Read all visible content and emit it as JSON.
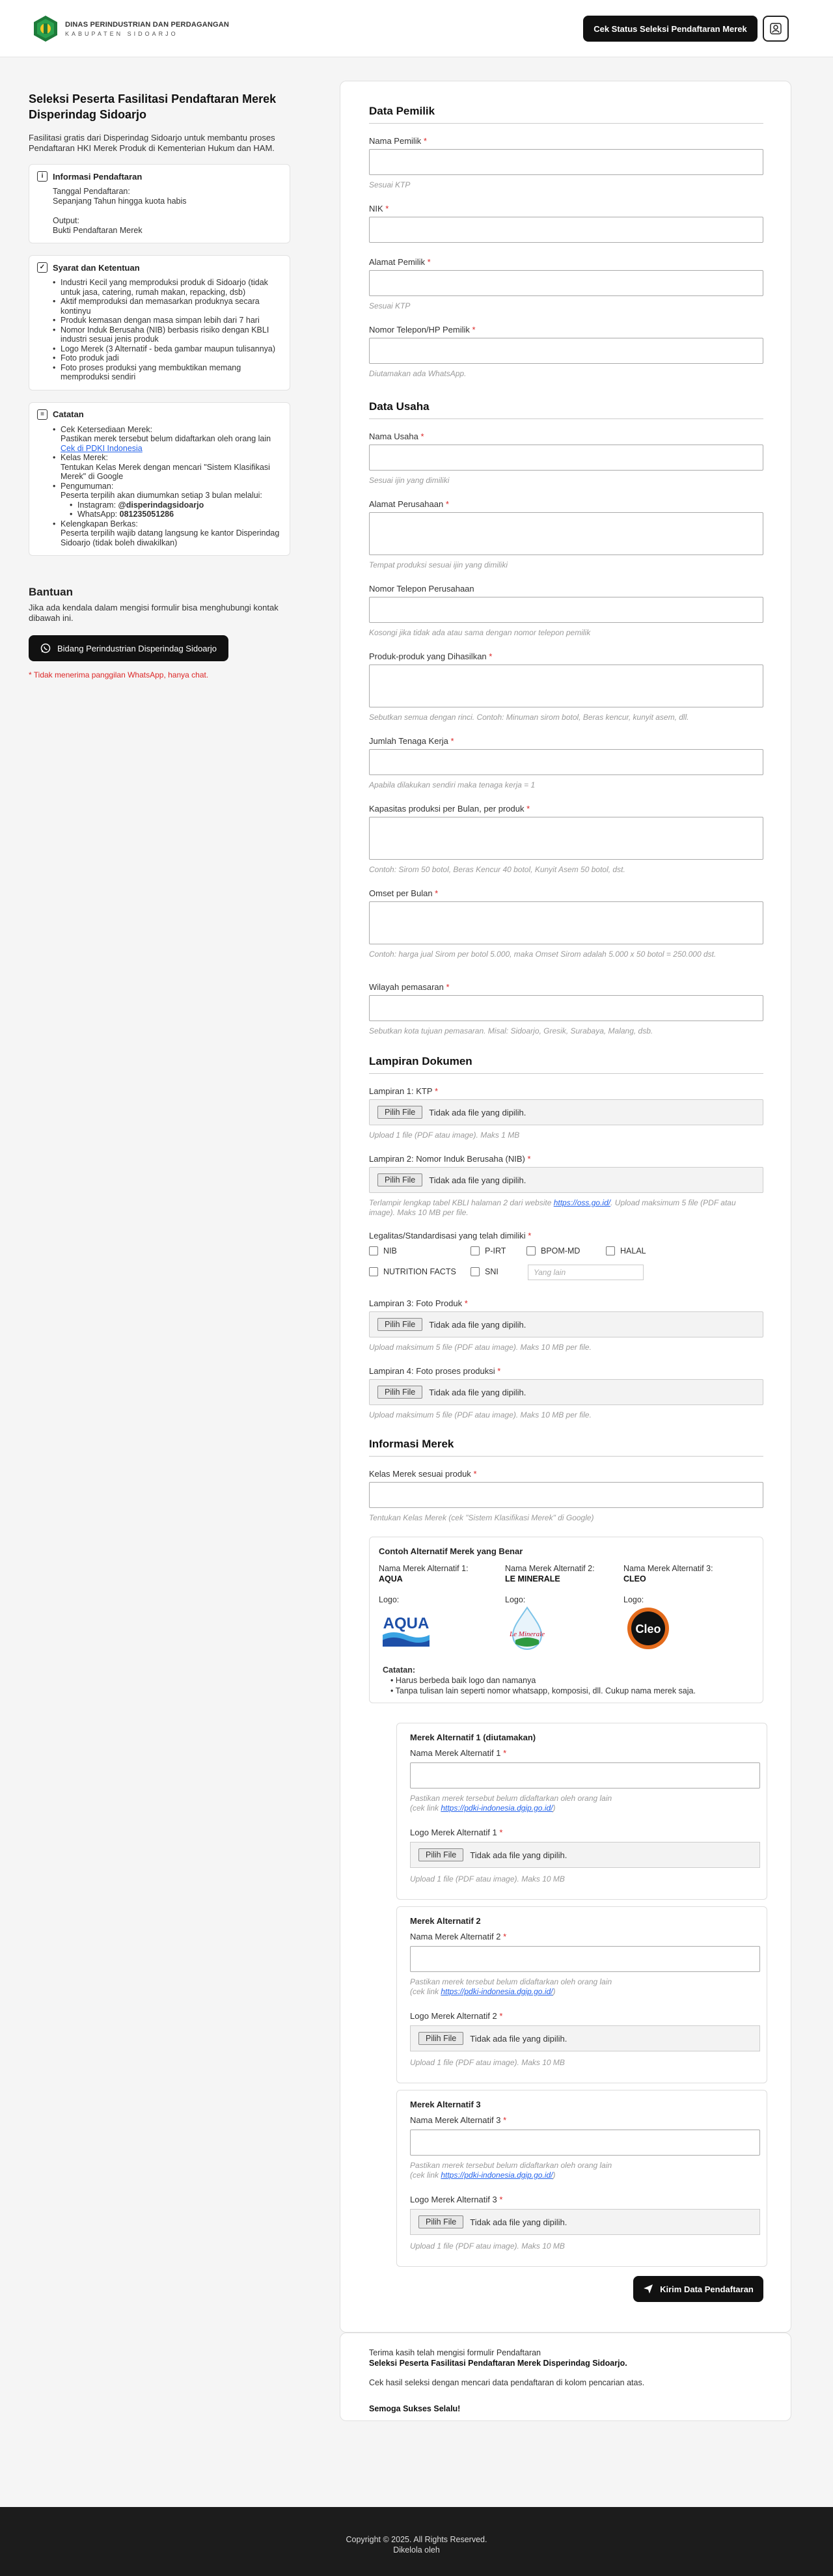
{
  "header": {
    "logo_line1": "DINAS PERINDUSTRIAN DAN PERDAGANGAN",
    "logo_line2": "KABUPATEN SIDOARJO",
    "cek_status": "Cek Status Seleksi Pendaftaran Merek"
  },
  "left": {
    "title": "Seleksi Peserta Fasilitasi Pendaftaran Merek Disperindag Sidoarjo",
    "intro": "Fasilitasi gratis dari Disperindag Sidoarjo untuk membantu proses Pendaftaran HKI Merek Produk di Kementerian Hukum dan HAM.",
    "info": {
      "title": "Informasi Pendaftaran",
      "tanggal_label": "Tanggal Pendaftaran:",
      "tanggal_value": "Sepanjang Tahun hingga kuota habis",
      "output_label": "Output:",
      "output_value": "Bukti Pendaftaran Merek"
    },
    "syarat": {
      "title": "Syarat dan Ketentuan",
      "items": [
        "Industri Kecil yang memproduksi produk di Sidoarjo (tidak untuk jasa, catering, rumah makan, repacking, dsb)",
        "Aktif memproduksi dan memasarkan produknya secara kontinyu",
        "Produk kemasan dengan masa simpan lebih dari 7 hari",
        "Nomor Induk Berusaha (NIB) berbasis risiko dengan KBLI industri sesuai jenis produk",
        "Logo Merek (3 Alternatif - beda gambar maupun tulisannya)",
        "Foto produk jadi",
        "Foto proses produksi yang membuktikan memang memproduksi sendiri"
      ]
    },
    "catatan": {
      "title": "Catatan",
      "i1_title": "Cek Ketersediaan Merek:",
      "i1_text": "Pastikan merek tersebut belum didaftarkan oleh orang lain",
      "i1_link": "Cek di PDKI Indonesia",
      "i2_title": "Kelas Merek:",
      "i2_text": "Tentukan Kelas Merek dengan mencari \"Sistem Klasifikasi Merek\" di Google",
      "i3_title": "Pengumuman:",
      "i3_text": "Peserta terpilih akan diumumkan setiap 3 bulan melalui:",
      "instagram_label": "Instagram:",
      "instagram_value": "@disperindagsidoarjo",
      "whatsapp_label": "WhatsApp:",
      "whatsapp_value": "081235051286",
      "i4_title": "Kelengkapan Berkas:",
      "i4_text": "Peserta terpilih wajib datang langsung ke kantor Disperindag Sidoarjo (tidak boleh diwakilkan)"
    },
    "bantuan": {
      "title": "Bantuan",
      "text": "Jika ada kendala dalam mengisi formulir bisa menghubungi kontak dibawah ini.",
      "wa_button": "Bidang Perindustrian Disperindag Sidoarjo",
      "wa_note": "* Tidak menerima panggilan WhatsApp, hanya chat."
    }
  },
  "form": {
    "pemilik_title": "Data Pemilik",
    "nama_pemilik": "Nama Pemilik",
    "nama_pemilik_hint": "Sesuai KTP",
    "nik": "NIK",
    "alamat_pemilik": "Alamat Pemilik",
    "alamat_pemilik_hint": "Sesuai KTP",
    "telp_pemilik": "Nomor Telepon/HP Pemilik",
    "telp_pemilik_hint": "Diutamakan ada WhatsApp.",
    "usaha_title": "Data Usaha",
    "nama_usaha": "Nama Usaha",
    "nama_usaha_hint": "Sesuai ijin yang dimiliki",
    "alamat_perusahaan": "Alamat Perusahaan",
    "alamat_perusahaan_hint": "Tempat produksi sesuai ijin yang dimiliki",
    "telp_perusahaan": "Nomor Telepon Perusahaan",
    "telp_perusahaan_hint": "Kosongi jika tidak ada atau sama dengan nomor telepon pemilik",
    "produk": "Produk-produk yang Dihasilkan",
    "produk_hint": "Sebutkan semua dengan rinci. Contoh: Minuman sirom botol, Beras kencur, kunyit asem, dll.",
    "tenaga": "Jumlah Tenaga Kerja",
    "tenaga_hint": "Apabila dilakukan sendiri maka tenaga kerja = 1",
    "kapasitas": "Kapasitas produksi per Bulan, per produk",
    "kapasitas_hint": "Contoh: Sirom 50 botol, Beras Kencur 40 botol, Kunyit Asem 50 botol, dst.",
    "omset": "Omset per Bulan",
    "omset_hint": "Contoh: harga jual Sirom per botol 5.000, maka Omset Sirom adalah 5.000 x 50 botol = 250.000 dst.",
    "wilayah": "Wilayah pemasaran",
    "wilayah_hint": "Sebutkan kota tujuan pemasaran. Misal: Sidoarjo, Gresik, Surabaya, Malang, dsb.",
    "lampiran_title": "Lampiran Dokumen",
    "lamp1": "Lampiran 1: KTP",
    "lamp1_hint": "Upload 1 file (PDF atau image). Maks 1 MB",
    "lamp2": "Lampiran 2: Nomor Induk Berusaha (NIB)",
    "lamp2_hint_a": "Terlampir lengkap tabel KBLI halaman 2 dari website ",
    "lamp2_link": "https://oss.go.id/",
    "lamp2_hint_b": ". Upload maksimum 5 file (PDF atau image). Maks 10 MB per file.",
    "legalitas": "Legalitas/Standardisasi yang telah dimiliki",
    "legal_options": [
      "NIB",
      "P-IRT",
      "BPOM-MD",
      "HALAL",
      "NUTRITION FACTS",
      "SNI"
    ],
    "yang_lain": "Yang lain",
    "lamp3": "Lampiran 3: Foto Produk",
    "lamp3_hint": "Upload maksimum 5 file (PDF atau image). Maks 10 MB per file.",
    "lamp4": "Lampiran 4: Foto proses produksi",
    "lamp4_hint": "Upload maksimum 5 file (PDF atau image). Maks 10 MB per file.",
    "file_button": "Pilih File",
    "file_empty": "Tidak ada file yang dipilih.",
    "merek_title": "Informasi Merek",
    "kelas": "Kelas Merek sesuai produk",
    "kelas_hint": "Tentukan Kelas Merek (cek \"Sistem Klasifikasi Merek\" di Google)",
    "contoh_title": "Contoh Alternatif Merek yang Benar",
    "contoh": [
      {
        "label": "Nama Merek Alternatif 1:",
        "value": "AQUA",
        "logo_label": "Logo:",
        "logo_text": "AQUA"
      },
      {
        "label": "Nama Merek Alternatif 2:",
        "value": "LE MINERALE",
        "logo_label": "Logo:",
        "logo_text": "Le Minerale"
      },
      {
        "label": "Nama Merek Alternatif 3:",
        "value": "CLEO",
        "logo_label": "Logo:",
        "logo_text": "Cleo"
      }
    ],
    "contoh_catatan": "Catatan:",
    "contoh_notes": [
      "Harus berbeda baik logo dan namanya",
      "Tanpa tulisan lain seperti nomor whatsapp, komposisi, dll. Cukup nama merek saja."
    ],
    "alt": [
      {
        "title": "Merek Alternatif 1 (diutamakan)",
        "nama": "Nama Merek Alternatif 1",
        "logo": "Logo Merek Alternatif 1"
      },
      {
        "title": "Merek Alternatif 2",
        "nama": "Nama Merek Alternatif 2",
        "logo": "Logo Merek Alternatif 2"
      },
      {
        "title": "Merek Alternatif 3",
        "nama": "Nama Merek Alternatif 3",
        "logo": "Logo Merek Alternatif 3"
      }
    ],
    "alt_hint_a": "Pastikan merek tersebut belum didaftarkan oleh orang lain",
    "alt_hint_b": "(cek link ",
    "alt_hint_link": "https://pdki-indonesia.dgip.go.id/",
    "alt_hint_c": ")",
    "alt_logo_hint": "Upload 1 file (PDF atau image). Maks 10 MB",
    "submit": "Kirim Data Pendaftaran",
    "required_mark": "*"
  },
  "thanks": {
    "line1": "Terima kasih telah mengisi formulir Pendaftaran",
    "line2": "Seleksi Peserta Fasilitasi Pendaftaran Merek Disperindag Sidoarjo.",
    "line3": "Cek hasil seleksi dengan mencari data pendaftaran di kolom pencarian atas.",
    "line4": "Semoga Sukses Selalu!"
  },
  "footer": {
    "copyright": "Copyright © 2025. All Rights Reserved.",
    "managed": "Dikelola oleh"
  }
}
